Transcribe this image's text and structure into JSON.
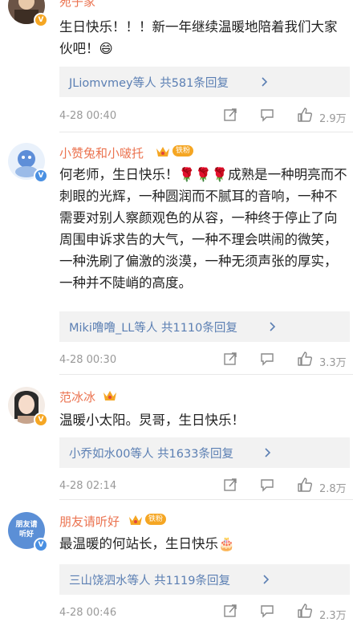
{
  "comments": [
    {
      "name": "宛子家",
      "text": "生日快乐！！！新一年继续温暖地陪着我们大家伙吧！😄",
      "reply_prefix": "JLiomvmey等人",
      "reply_count": "共581条回复",
      "date": "4-28 00:40",
      "likes": "2.9万"
    },
    {
      "name": "小赞兔和小啵托",
      "badge": "铁粉",
      "text": "何老师，生日快乐！🌹🌹🌹成熟是一种明亮而不刺眼的光辉，一种圆润而不腻耳的音响，一种不需要对别人察颜观色的从容，一种终于停止了向周围申诉求告的大气，一种不理会哄闹的微笑，一种洗刷了偏激的淡漠，一种无须声张的厚实，一种并不陡峭的高度。",
      "reply_prefix": "Miki噜噜_LL等人",
      "reply_count": "共1110条回复",
      "date": "4-28 00:30",
      "likes": "3.3万"
    },
    {
      "name": "范冰冰",
      "text": "温暖小太阳。炅哥，生日快乐！",
      "reply_prefix": "小乔如水00等人",
      "reply_count": "共1633条回复",
      "date": "4-28 02:14",
      "likes": "2.8万"
    },
    {
      "name": "朋友请听好",
      "avatar_text": "朋友请听好",
      "badge": "铁粉",
      "text": "最温暖的何站长，生日快乐🎂",
      "reply_prefix": "三山饶泗水等人",
      "reply_count": "共1119条回复",
      "date": "4-28 00:46",
      "likes": "2.3万"
    }
  ],
  "icons": {
    "verified": "v-badge-icon",
    "crown": "crown-icon",
    "share": "share-icon",
    "comment": "comment-icon",
    "like": "thumb-up-icon",
    "chevron": "chevron-right-icon"
  },
  "colors": {
    "name": "#eb7350",
    "link": "#5b7fb3",
    "meta": "#999999",
    "reply_bg": "#f2f2f2",
    "badge": "#f5a623"
  }
}
